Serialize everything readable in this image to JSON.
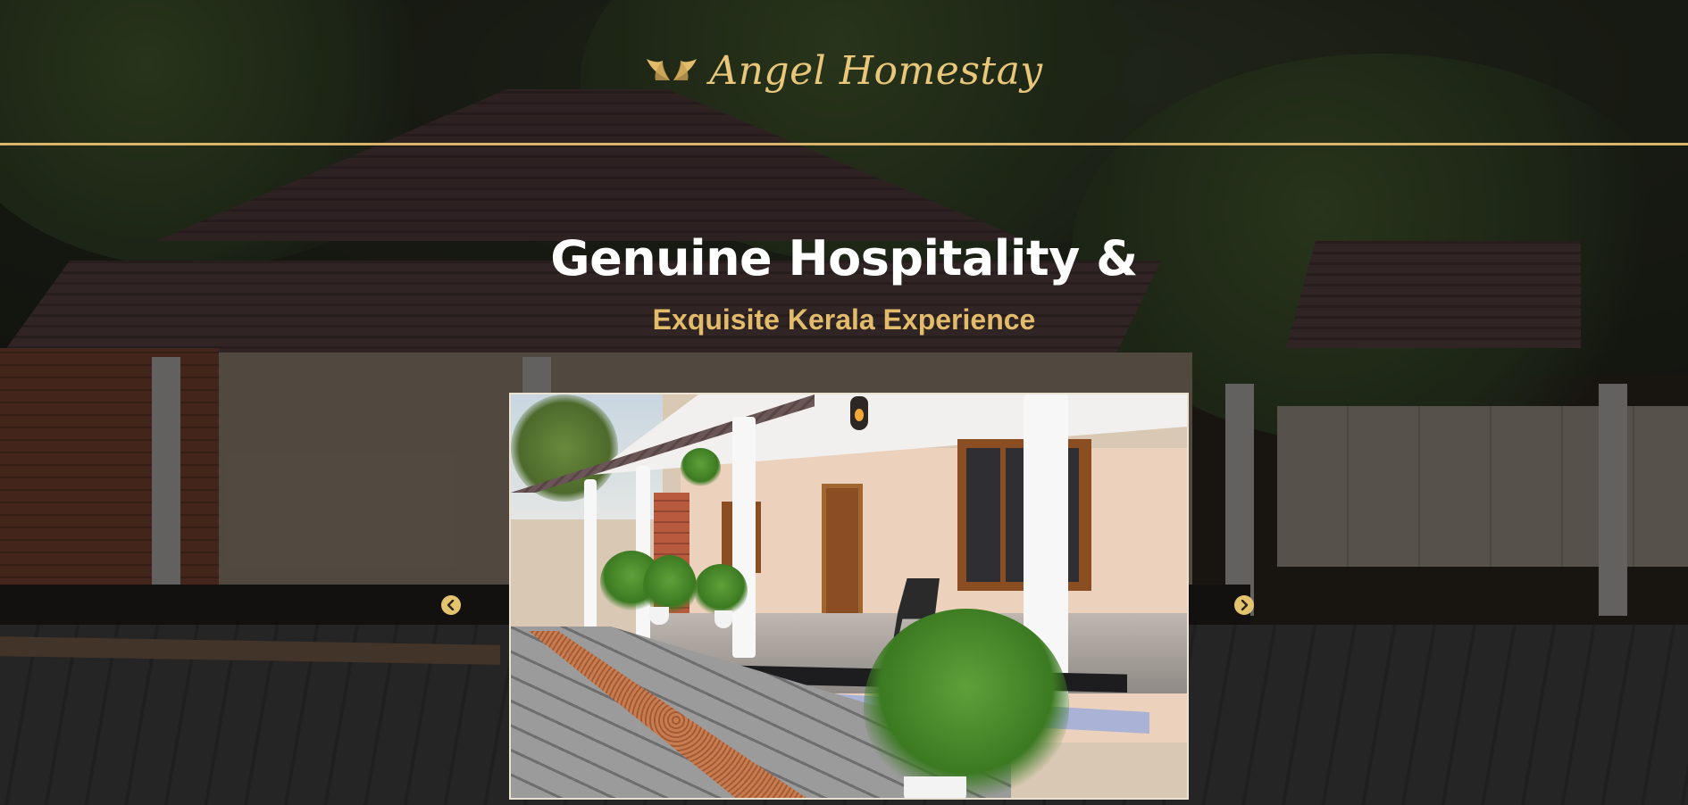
{
  "brand": {
    "icon": "angel-wings-logo",
    "name": "Angel Homestay"
  },
  "hero": {
    "headline": "Genuine Hospitality &",
    "subline": "Exquisite Kerala Experience"
  },
  "carousel": {
    "prev_icon": "chevron-left-icon",
    "next_icon": "chevron-right-icon",
    "slide_image": "homestay-veranda-photo"
  },
  "colors": {
    "accent_gold": "#e2bc6a",
    "rule_gold": "#d8b46c",
    "headline_white": "#ffffff"
  }
}
